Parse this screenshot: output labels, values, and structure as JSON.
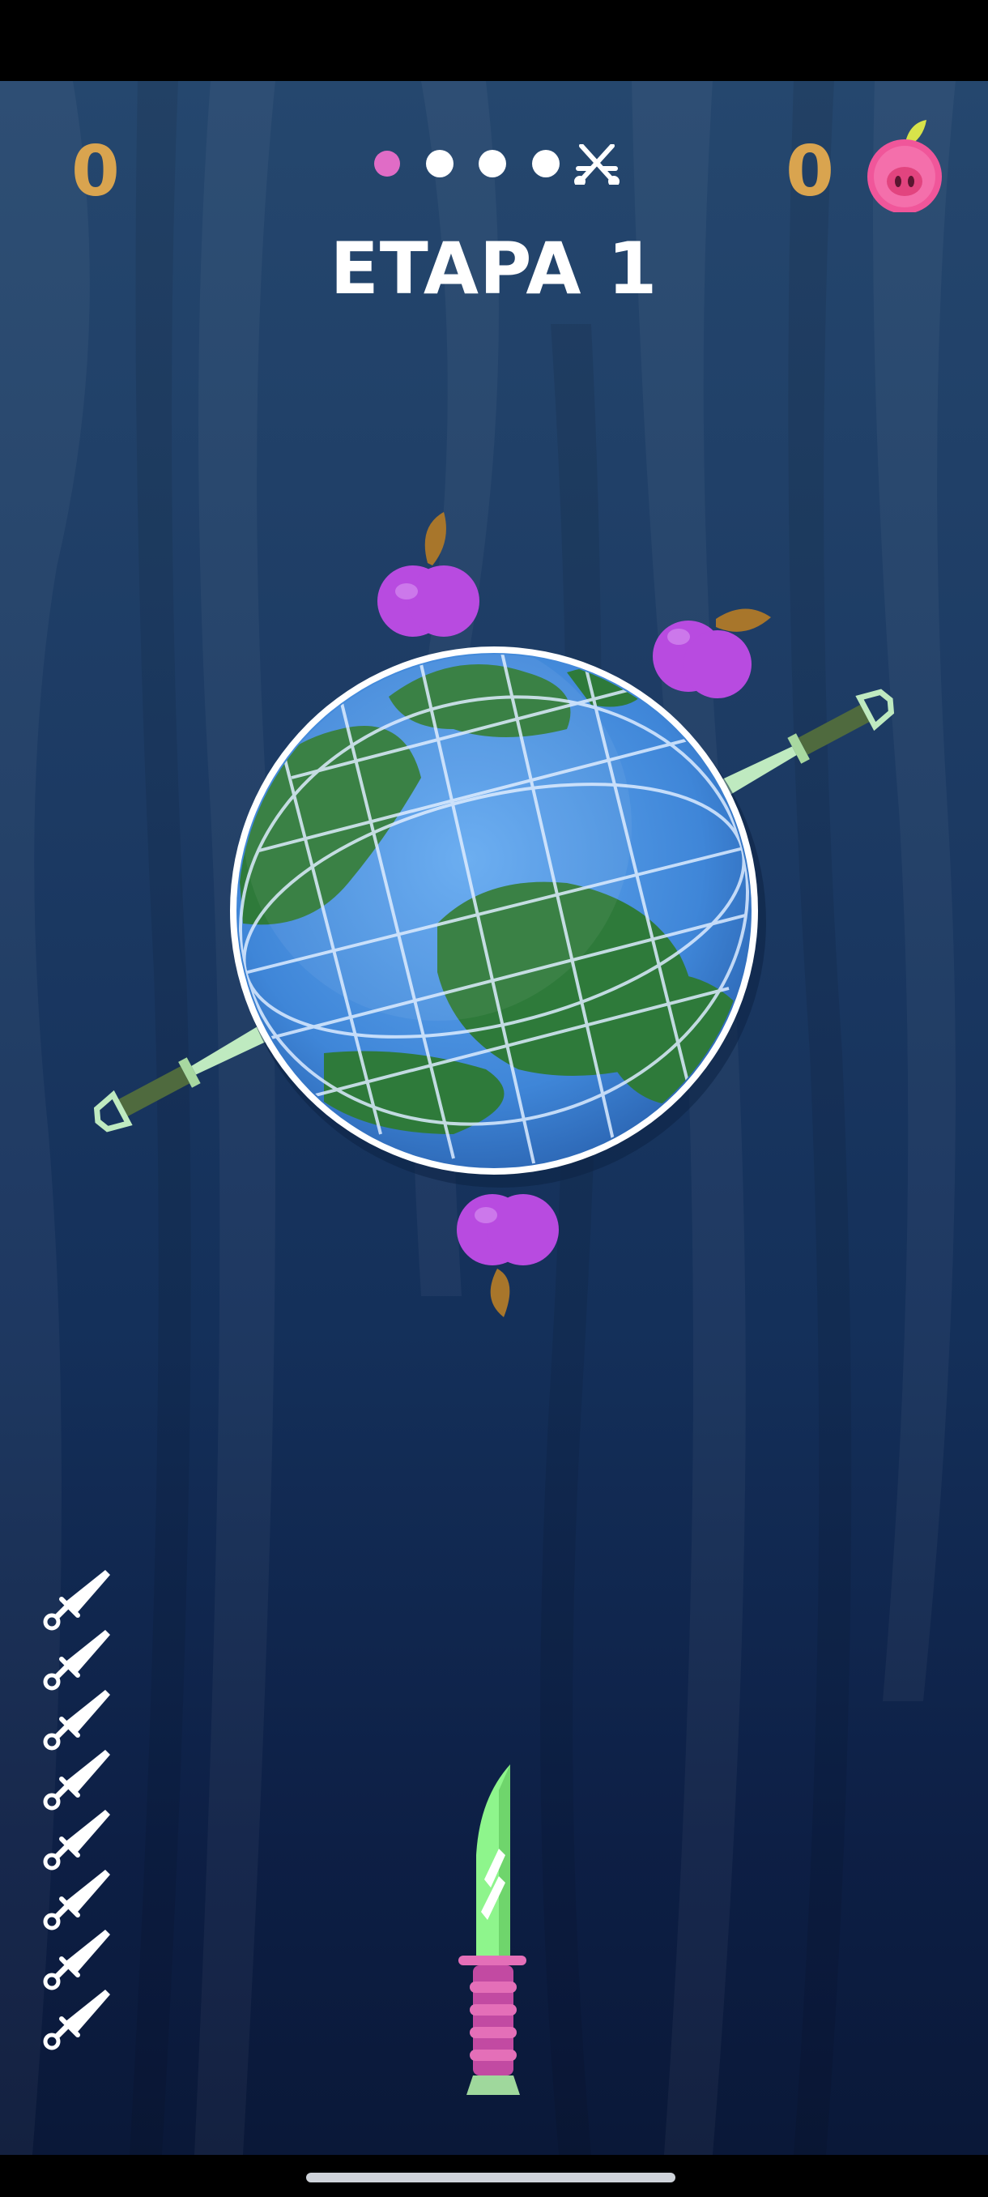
{
  "hud": {
    "score": "0",
    "apples": "0",
    "stage_title": "ETAPA 1",
    "stage_progress": {
      "current": 1,
      "total_dots": 4,
      "boss_icon": "crossed-swords-icon"
    }
  },
  "knives_remaining": 8,
  "icons": {
    "apple_counter": "apple-icon",
    "target": "globe-target",
    "stack_knife": "knife-icon"
  },
  "colors": {
    "score_text": "#d9a44f",
    "active_dot": "#e06cc6",
    "inactive_dot": "#ffffff",
    "apple": "#b84be0",
    "knife_blade": "#8ef58c",
    "knife_handle": "#c24aa2"
  }
}
